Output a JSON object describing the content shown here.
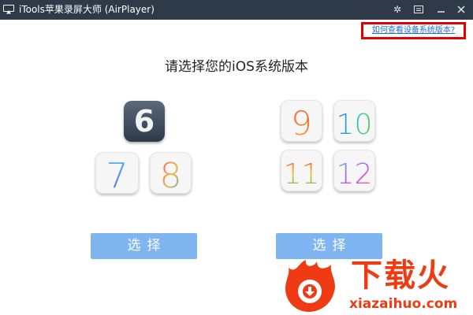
{
  "window": {
    "title": "iTools苹果录屏大师 (AirPlayer)",
    "controls": {
      "settings_icon": "gear-icon",
      "menu_icon": "window-menu-icon",
      "minimize_icon": "minimize-icon",
      "close_icon": "close-icon"
    }
  },
  "help": {
    "link_text": "如何查看设备系统版本?"
  },
  "main": {
    "heading": "请选择您的iOS系统版本",
    "left_group": {
      "versions": [
        "6",
        "7",
        "8"
      ],
      "select_label": "选择"
    },
    "right_group": {
      "versions": [
        "9",
        "10",
        "11",
        "12"
      ],
      "select_label": "选择"
    }
  },
  "watermark": {
    "brand": "下载火",
    "url": "xiazaihuo.com"
  },
  "colors": {
    "titlebar": "#2f3a49",
    "select_button": "#7fb6f2",
    "link": "#1e6fd6",
    "highlight_border": "#e00000",
    "watermark": "#ee3b14"
  }
}
